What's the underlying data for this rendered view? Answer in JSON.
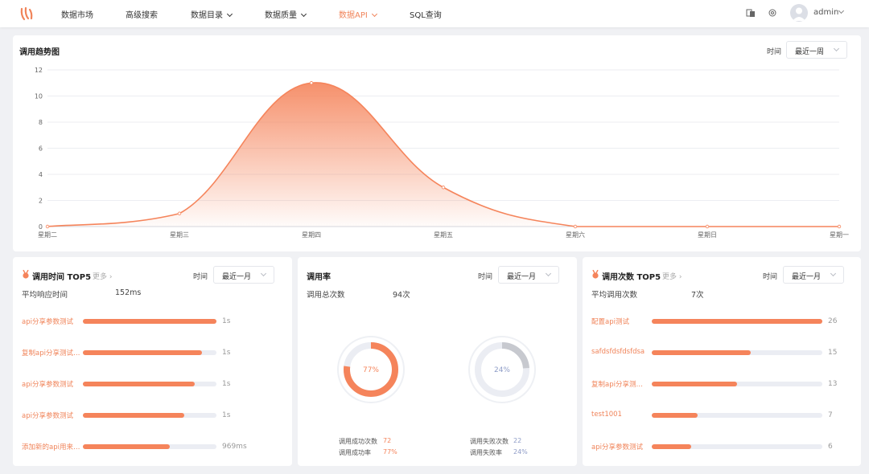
{
  "colors": {
    "accent": "#f5845b",
    "success": "#f5845b",
    "failure": "#8e9cc7",
    "track": "#ebedf3"
  },
  "nav": {
    "items": [
      {
        "label": "数据市场",
        "dropdown": false,
        "active": false
      },
      {
        "label": "高级搜索",
        "dropdown": false,
        "active": false
      },
      {
        "label": "数据目录",
        "dropdown": true,
        "active": false
      },
      {
        "label": "数据质量",
        "dropdown": true,
        "active": false
      },
      {
        "label": "数据API",
        "dropdown": true,
        "active": true
      },
      {
        "label": "SQL查询",
        "dropdown": false,
        "active": false
      }
    ],
    "icons": [
      "translate-icon",
      "settings-icon"
    ],
    "user": "admin"
  },
  "trend": {
    "title": "调用趋势图",
    "time_label": "时间",
    "range": "最近一周"
  },
  "chart_data": {
    "type": "area",
    "title": "调用趋势图",
    "categories": [
      "星期二",
      "星期三",
      "星期四",
      "星期五",
      "星期六",
      "星期日",
      "星期一"
    ],
    "series": [
      {
        "values": [
          0,
          1,
          11,
          3,
          0,
          0,
          0
        ]
      }
    ],
    "ylim": [
      0,
      12
    ],
    "yticks": [
      0,
      2,
      4,
      6,
      8,
      10,
      12
    ],
    "grid": true,
    "smooth": true
  },
  "time_top5": {
    "title": "调用时间 TOP5",
    "more": "更多",
    "time_label": "时间",
    "range": "最近一月",
    "summary_label": "平均响应时间",
    "summary_value": "152ms",
    "items": [
      {
        "name": "api分享参数测试",
        "value": "1s",
        "ratio": 1.0
      },
      {
        "name": "复制api分享测试S...",
        "value": "1s",
        "ratio": 0.89
      },
      {
        "name": "api分享参数测试",
        "value": "1s",
        "ratio": 0.84
      },
      {
        "name": "api分享参数测试",
        "value": "1s",
        "ratio": 0.76
      },
      {
        "name": "添加新的api用来S...",
        "value": "969ms",
        "ratio": 0.65
      }
    ]
  },
  "rate": {
    "title": "调用率",
    "time_label": "时间",
    "range": "最近一月",
    "summary_label": "调用总次数",
    "summary_value": "94次",
    "success_percent": 77,
    "success_text": "77%",
    "failure_percent": 24,
    "failure_text": "24%",
    "success_count_label": "调用成功次数",
    "success_count": "72",
    "success_rate_label": "调用成功率",
    "success_rate": "77%",
    "failure_count_label": "调用失败次数",
    "failure_count": "22",
    "failure_rate_label": "调用失败率",
    "failure_rate": "24%"
  },
  "count_top5": {
    "title": "调用次数 TOP5",
    "more": "更多",
    "time_label": "时间",
    "range": "最近一月",
    "summary_label": "平均调用次数",
    "summary_value": "7次",
    "items": [
      {
        "name": "配置api测试",
        "value": "26",
        "ratio": 1.0
      },
      {
        "name": "safdsfdsfdsfdsa",
        "value": "15",
        "ratio": 0.58
      },
      {
        "name": "复制api分享测试S...",
        "value": "13",
        "ratio": 0.5
      },
      {
        "name": "test1001",
        "value": "7",
        "ratio": 0.27
      },
      {
        "name": "api分享参数测试",
        "value": "6",
        "ratio": 0.23
      }
    ]
  }
}
